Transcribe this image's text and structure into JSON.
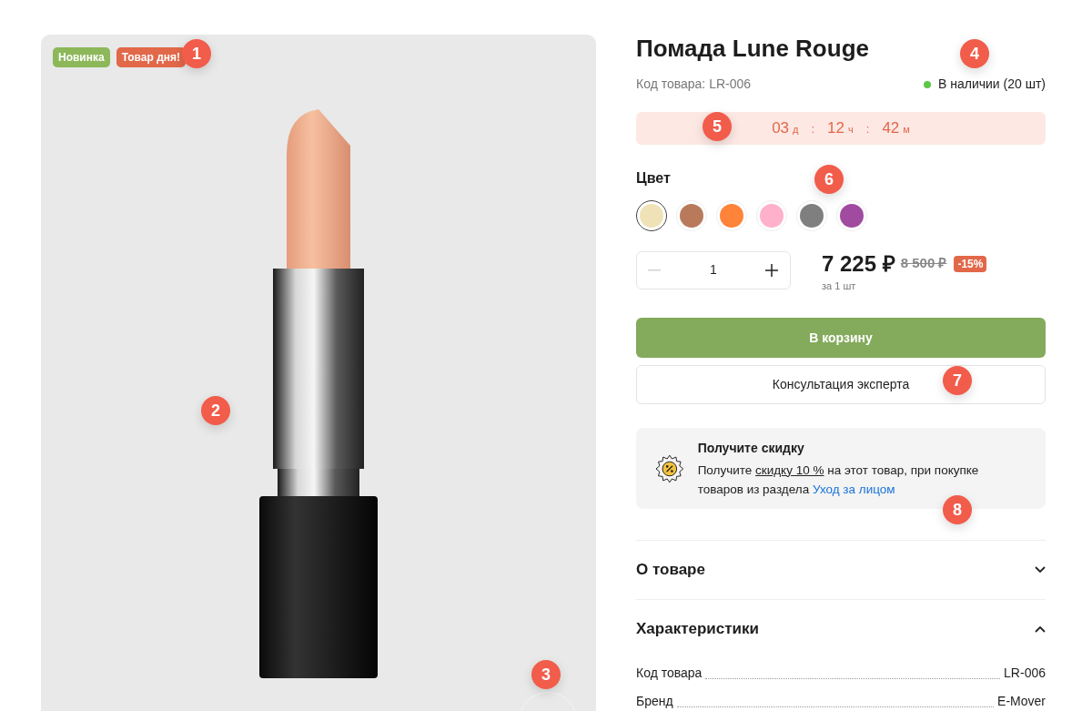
{
  "gallery": {
    "badges": [
      {
        "text": "Новинка",
        "color": "#8cb85a"
      },
      {
        "text": "Товар дня!",
        "color": "#e2684a"
      }
    ]
  },
  "product": {
    "title": "Помада Lune Rouge",
    "sku": "Код товара: LR-006",
    "stock": {
      "text": "В наличии (20 шт)",
      "in_stock": true
    }
  },
  "timer": [
    {
      "value": "03",
      "unit": "д"
    },
    {
      "value": "12",
      "unit": "ч"
    },
    {
      "value": "42",
      "unit": "м"
    }
  ],
  "timer_separator": ":",
  "colors": {
    "label": "Цвет",
    "swatches": [
      {
        "color": "#efe2b6",
        "selected": true
      },
      {
        "color": "#b97a5c",
        "selected": false
      },
      {
        "color": "#ff8339",
        "selected": false
      },
      {
        "color": "#ffb0cb",
        "selected": false
      },
      {
        "color": "#7f7f7f",
        "selected": false
      },
      {
        "color": "#a04ba0",
        "selected": false
      }
    ]
  },
  "quantity": {
    "value": "1",
    "minus_disabled": true
  },
  "price": {
    "current": "7 225 ₽",
    "old": "8 500 ₽",
    "discount": "-15%",
    "unit": "за 1 шт"
  },
  "buttons": {
    "cart": "В корзину",
    "consult": "Консультация эксперта"
  },
  "promo": {
    "title": "Получите скидку",
    "text_before": "Получите ",
    "text_underlined": "скидку 10 %",
    "text_after": " на этот товар, при покупке товаров из раздела ",
    "link": "Уход за лицом"
  },
  "accordion": [
    {
      "title": "О товаре",
      "expanded": false
    },
    {
      "title": "Характеристики",
      "expanded": true,
      "specs": [
        {
          "name": "Код товара",
          "value": "LR-006"
        },
        {
          "name": "Бренд",
          "value": "E-Mover"
        }
      ]
    }
  ],
  "callouts": [
    "1",
    "2",
    "3",
    "4",
    "5",
    "6",
    "7",
    "8"
  ]
}
